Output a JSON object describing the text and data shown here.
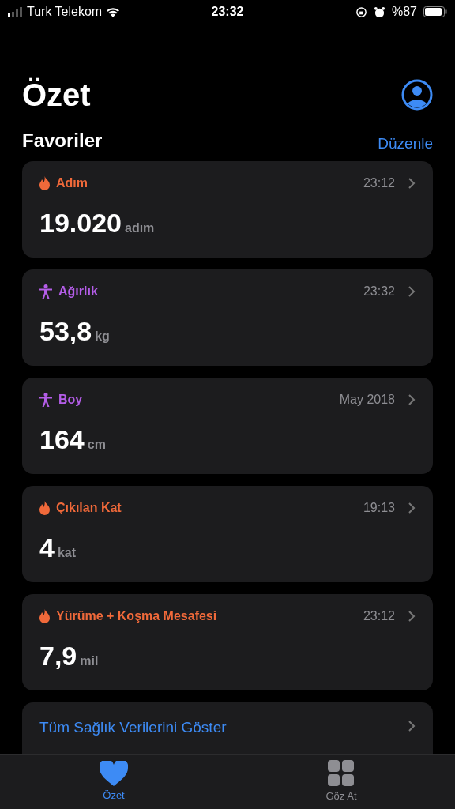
{
  "status_bar": {
    "carrier": "Turk Telekom",
    "time": "23:32",
    "battery": "%87"
  },
  "title": "Özet",
  "favorites": {
    "heading": "Favoriler",
    "edit": "Düzenle",
    "cards": [
      {
        "kind": "flame",
        "color": "#f0693a",
        "label": "Adım",
        "time": "23:12",
        "value": "19.020",
        "unit": "adım"
      },
      {
        "kind": "figure",
        "color": "#b45de8",
        "label": "Ağırlık",
        "time": "23:32",
        "value": "53,8",
        "unit": "kg"
      },
      {
        "kind": "figure",
        "color": "#b45de8",
        "label": "Boy",
        "time": "May 2018",
        "value": "164",
        "unit": "cm"
      },
      {
        "kind": "flame",
        "color": "#f0693a",
        "label": "Çıkılan Kat",
        "time": "19:13",
        "value": "4",
        "unit": "kat"
      },
      {
        "kind": "flame",
        "color": "#f0693a",
        "label": "Yürüme + Koşma Mesafesi",
        "time": "23:12",
        "value": "7,9",
        "unit": "mil"
      }
    ]
  },
  "show_all": "Tüm Sağlık Verilerini Göster",
  "tabs": [
    {
      "kind": "heart",
      "label": "Özet",
      "selected": true
    },
    {
      "kind": "grid",
      "label": "Göz At",
      "selected": false
    }
  ]
}
